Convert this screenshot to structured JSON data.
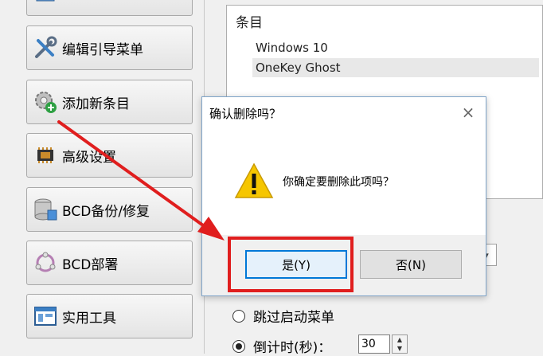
{
  "sidebar": {
    "items": [
      {
        "label": "",
        "icon": "window-icon"
      },
      {
        "label": "编辑引导菜单",
        "icon": "tools-icon"
      },
      {
        "label": "添加新条目",
        "icon": "add-entry-icon"
      },
      {
        "label": "高级设置",
        "icon": "chip-icon"
      },
      {
        "label": "BCD备份/修复",
        "icon": "database-icon"
      },
      {
        "label": "BCD部署",
        "icon": "deploy-icon"
      },
      {
        "label": "实用工具",
        "icon": "utility-icon"
      }
    ]
  },
  "entries": {
    "header": "条目",
    "items": [
      "Windows 10",
      "OneKey Ghost"
    ],
    "selected_index": 1
  },
  "options": {
    "skip_menu_label": "跳过启动菜单",
    "countdown_label": "倒计时(秒)：",
    "countdown_value": "30"
  },
  "dialog": {
    "title": "确认删除吗？",
    "message": "你确定要删除此项吗？",
    "yes_label": "是(Y)",
    "no_label": "否(N)"
  },
  "colors": {
    "annotation_red": "#e01e1e",
    "focus_blue": "#0078d7",
    "warning_yellow": "#f6c600"
  }
}
